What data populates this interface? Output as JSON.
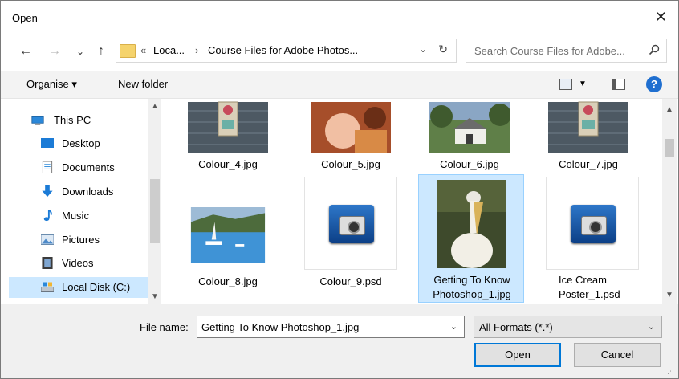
{
  "window": {
    "title": "Open",
    "close_glyph": "✕"
  },
  "nav_buttons": {
    "back": "←",
    "forward": "→",
    "recent": "⌄",
    "up": "↑"
  },
  "address": {
    "prefix": "«",
    "crumbs": [
      "Loca...",
      "›",
      "Course Files for Adobe Photos..."
    ],
    "dropdown": "⌄",
    "refresh": "↻"
  },
  "search": {
    "placeholder": "Search Course Files for Adobe...",
    "icon": "magnifier-icon"
  },
  "toolbar": {
    "organise": "Organise ▾",
    "new_folder": "New folder",
    "help": "?"
  },
  "sidebar": {
    "items": [
      {
        "label": "This PC",
        "icon": "computer-icon"
      },
      {
        "label": "Desktop",
        "icon": "desktop-icon"
      },
      {
        "label": "Documents",
        "icon": "documents-icon"
      },
      {
        "label": "Downloads",
        "icon": "downloads-icon"
      },
      {
        "label": "Music",
        "icon": "music-icon"
      },
      {
        "label": "Pictures",
        "icon": "pictures-icon"
      },
      {
        "label": "Videos",
        "icon": "videos-icon"
      },
      {
        "label": "Local Disk (C:)",
        "icon": "disk-icon",
        "selected": true
      }
    ]
  },
  "files": [
    {
      "name": "Colour_4.jpg"
    },
    {
      "name": "Colour_5.jpg"
    },
    {
      "name": "Colour_6.jpg"
    },
    {
      "name": "Colour_7.jpg"
    },
    {
      "name": "Colour_8.jpg"
    },
    {
      "name": "Colour_9.psd"
    },
    {
      "name_line1": "Getting To Know",
      "name_line2": "Photoshop_1.jpg",
      "selected": true
    },
    {
      "name_line1": "Ice Cream",
      "name_line2": "Poster_1.psd"
    }
  ],
  "footer": {
    "file_name_label": "File name:",
    "file_name_value": "Getting To Know Photoshop_1.jpg",
    "filter_value": "All Formats (*.*)",
    "open_label": "Open",
    "cancel_label": "Cancel"
  },
  "colors": {
    "selection": "#cce8ff",
    "accent": "#0078d7"
  }
}
